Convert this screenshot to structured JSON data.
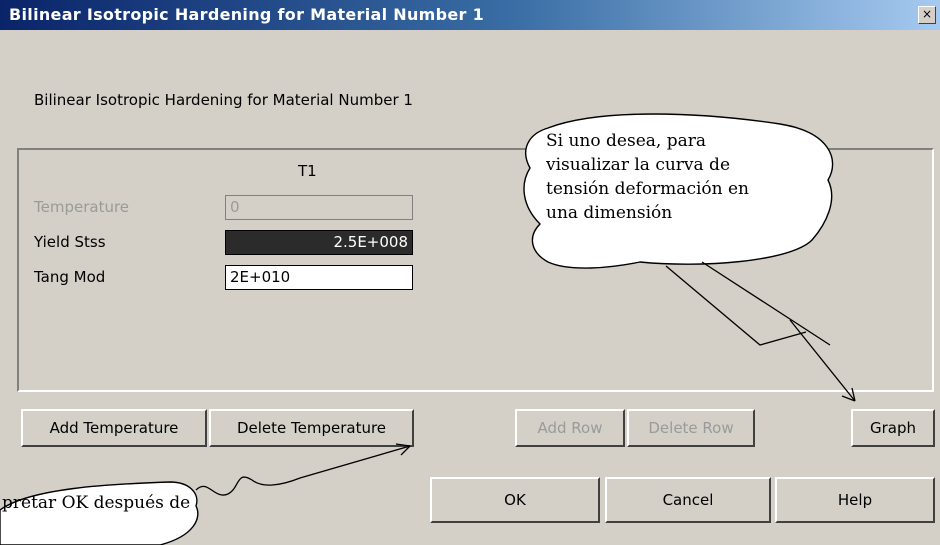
{
  "window": {
    "title": "Bilinear Isotropic Hardening for Material Number 1",
    "close_glyph": "×"
  },
  "heading": "Bilinear Isotropic Hardening for Material Number 1",
  "table": {
    "column_header": "T1",
    "rows": [
      {
        "label": "Temperature",
        "value": "0",
        "state": "disabled"
      },
      {
        "label": "Yield Stss",
        "value": "2.5E+008",
        "state": "selected"
      },
      {
        "label": "Tang Mod",
        "value": "2E+010",
        "state": "normal"
      }
    ]
  },
  "buttons": {
    "add_temperature": "Add Temperature",
    "delete_temperature": "Delete Temperature",
    "add_row": "Add Row",
    "delete_row": "Delete Row",
    "graph": "Graph",
    "ok": "OK",
    "cancel": "Cancel",
    "help": "Help"
  },
  "callouts": {
    "graph_note": [
      "Si uno desea, para",
      "visualizar la curva de",
      "tensión deformación en",
      "una dimensión"
    ],
    "ok_note": [
      "pretar OK después de",
      "..."
    ]
  }
}
